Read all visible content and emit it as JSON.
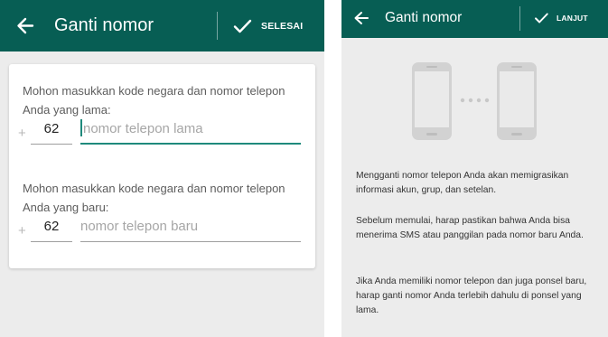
{
  "left_screen": {
    "title": "Ganti nomor",
    "action_label": "SELESAI",
    "old_section": {
      "prompt": "Mohon masukkan kode negara dan nomor telepon Anda yang lama:",
      "plus": "+",
      "country_code": "62",
      "placeholder": "nomor telepon lama"
    },
    "new_section": {
      "prompt": "Mohon masukkan kode negara dan nomor telepon Anda yang baru:",
      "plus": "+",
      "country_code": "62",
      "placeholder": "nomor telepon baru"
    }
  },
  "right_screen": {
    "title": "Ganti nomor",
    "action_label": "LANJUT",
    "paragraphs": [
      "Mengganti nomor telepon Anda akan memigrasikan informasi akun, grup, dan setelan.",
      "Sebelum memulai, harap pastikan bahwa Anda bisa menerima SMS atau panggilan pada nomor baru Anda.",
      "Jika Anda memiliki nomor telepon dan juga ponsel baru, harap ganti nomor Anda terlebih dahulu di ponsel yang lama."
    ]
  },
  "colors": {
    "appbar": "#075e54",
    "accent": "#1f8a7c",
    "background": "#ececec"
  },
  "icons": [
    "back-arrow-icon",
    "checkmark-icon",
    "phone-icon"
  ]
}
